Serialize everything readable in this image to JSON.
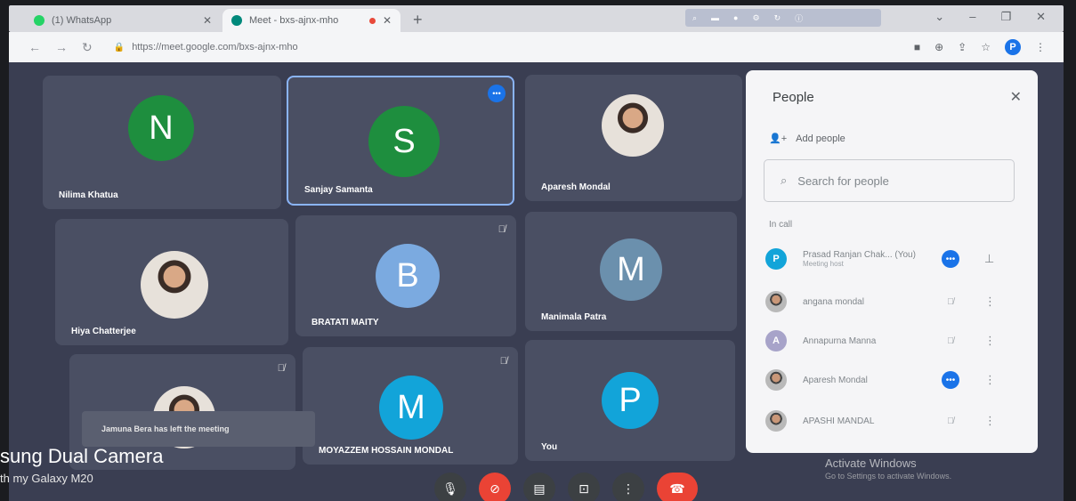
{
  "browser": {
    "tabs": [
      {
        "title": "(1) WhatsApp",
        "fav_color": "#25d366"
      },
      {
        "title": "Meet - bxs-ajnx-mho",
        "fav_color": "#00897b"
      }
    ],
    "url": "https://meet.google.com/bxs-ajnx-mho",
    "profile_initial": "P"
  },
  "tiles": [
    {
      "name": "Nilima Khatua",
      "initial": "N",
      "color": "#1e8e3e"
    },
    {
      "name": "Sanjay Samanta",
      "initial": "S",
      "color": "#1e8e3e"
    },
    {
      "name": "Aparesh Mondal"
    },
    {
      "name": "Hiya Chatterjee"
    },
    {
      "name": "BRATATI MAITY",
      "initial": "B",
      "color": "#7baae0"
    },
    {
      "name": "Manimala Patra",
      "initial": "M",
      "color": "#6b90ad"
    },
    {
      "name": ""
    },
    {
      "name": "MOYAZZEM HOSSAIN MONDAL",
      "initial": "M",
      "color": "#12a4d9"
    },
    {
      "name": "You",
      "initial": "P",
      "color": "#12a4d9"
    }
  ],
  "toast": "Jamuna Bera has left the meeting",
  "watermark": {
    "line1": "sung Dual Camera",
    "line2": "th my Galaxy M20"
  },
  "windows": {
    "activate": "Activate Windows",
    "sub": "Go to Settings to activate Windows."
  },
  "people_panel": {
    "title": "People",
    "add_people": "Add people",
    "search_placeholder": "Search for people",
    "in_call_label": "In call",
    "participants": [
      {
        "name": "Prasad Ranjan Chak...",
        "you_tag": "(You)",
        "sub": "Meeting host",
        "initial": "P",
        "color": "#12a4d9",
        "status": "speaking"
      },
      {
        "name": "angana mondal",
        "status": "muted"
      },
      {
        "name": "Annapurna Manna",
        "initial": "A",
        "color": "#a7a3c9",
        "status": "muted"
      },
      {
        "name": "Aparesh Mondal",
        "status": "speaking"
      },
      {
        "name": "APASHI MANDAL",
        "status": "muted"
      }
    ]
  }
}
